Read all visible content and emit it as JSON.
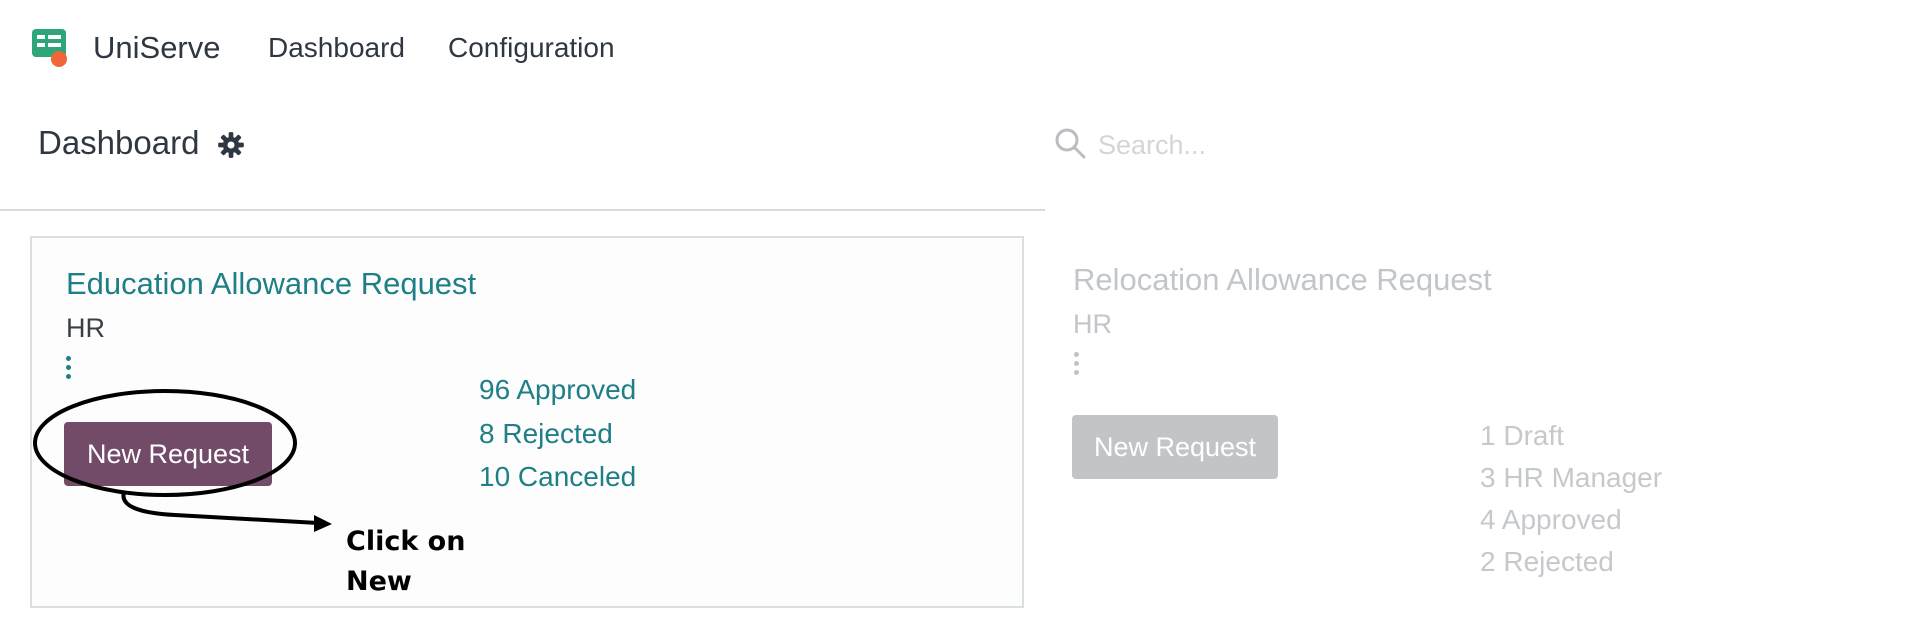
{
  "navbar": {
    "app_name": "UniServe",
    "menu": [
      "Dashboard",
      "Configuration"
    ]
  },
  "control_panel": {
    "title": "Dashboard",
    "search_placeholder": "Search..."
  },
  "cards": [
    {
      "title": "Education Allowance Request",
      "subtitle": "HR",
      "button": "New Request",
      "stats": [
        "96 Approved",
        "8 Rejected",
        "10 Canceled"
      ]
    },
    {
      "title": "Relocation Allowance Request",
      "subtitle": "HR",
      "button": "New Request",
      "stats": [
        "1 Draft",
        "3 HR Manager",
        "4 Approved",
        "2 Rejected"
      ]
    }
  ],
  "annotation": {
    "text_line1": "Click on",
    "text_line2": "New"
  },
  "icons": [
    "uniserve-logo-icon",
    "gear-icon",
    "search-icon",
    "kebab-menu-icon"
  ],
  "colors": {
    "accent_teal": "#1f7f86",
    "primary_button": "#714b67",
    "disabled_button": "#c2c4c6"
  }
}
